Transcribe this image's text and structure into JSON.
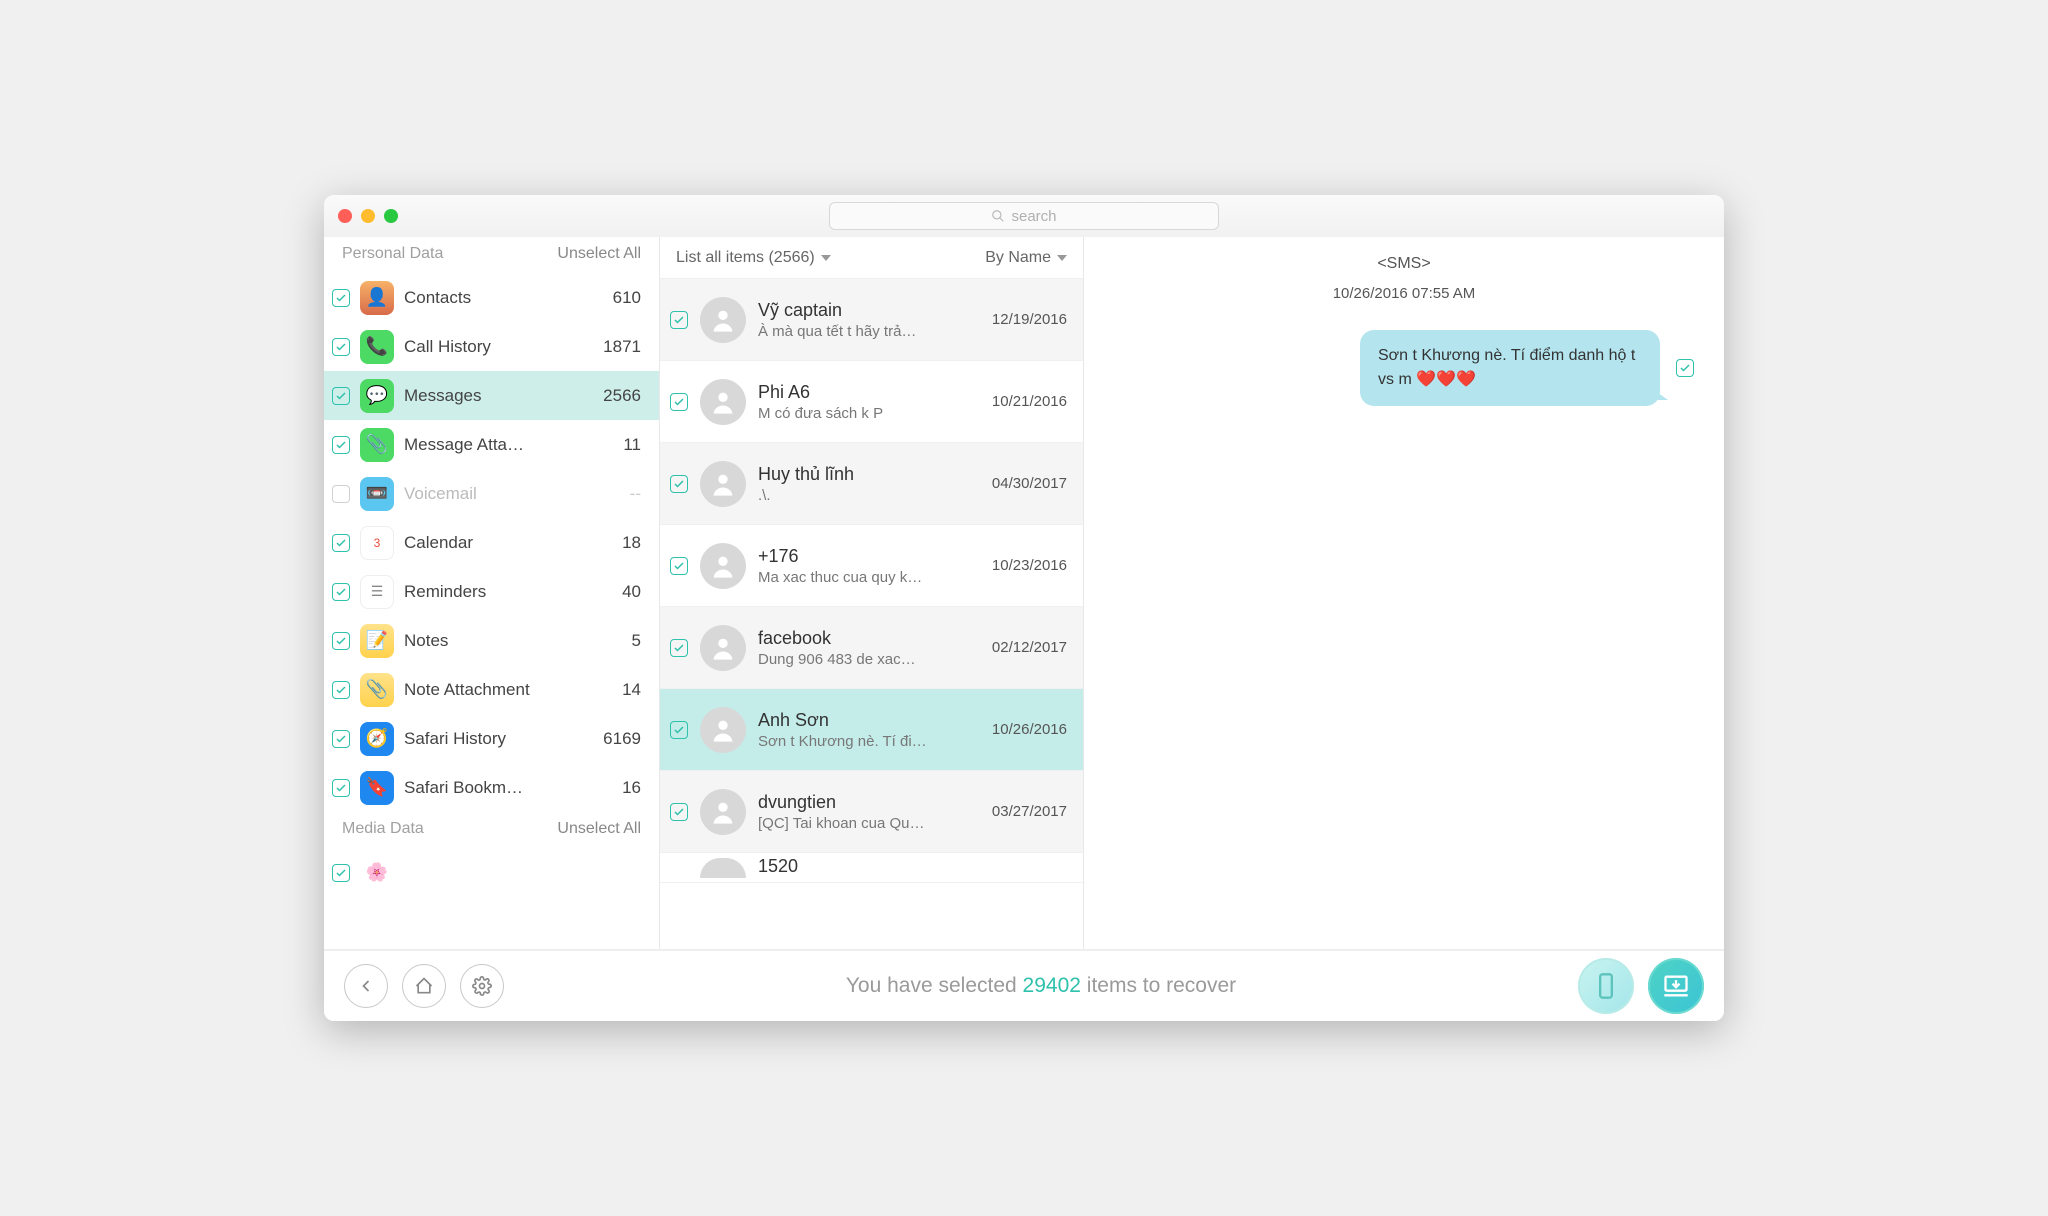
{
  "search": {
    "placeholder": "search"
  },
  "sidebar": {
    "section1": {
      "title": "Personal Data",
      "action": "Unselect All"
    },
    "section2": {
      "title": "Media Data",
      "action": "Unselect All"
    },
    "items": [
      {
        "label": "Contacts",
        "count": "610"
      },
      {
        "label": "Call History",
        "count": "1871"
      },
      {
        "label": "Messages",
        "count": "2566"
      },
      {
        "label": "Message Atta…",
        "count": "11"
      },
      {
        "label": "Voicemail",
        "count": "--"
      },
      {
        "label": "Calendar",
        "count": "18"
      },
      {
        "label": "Reminders",
        "count": "40"
      },
      {
        "label": "Notes",
        "count": "5"
      },
      {
        "label": "Note Attachment",
        "count": "14"
      },
      {
        "label": "Safari History",
        "count": "6169"
      },
      {
        "label": "Safari Bookm…",
        "count": "16"
      }
    ]
  },
  "list": {
    "header_left": "List all items (2566)",
    "header_right": "By Name",
    "items": [
      {
        "name": "Vỹ captain",
        "preview": "À mà qua tết t hãy trả…",
        "date": "12/19/2016"
      },
      {
        "name": "Phi A6",
        "preview": "M có đưa sách k P",
        "date": "10/21/2016"
      },
      {
        "name": "Huy thủ lĩnh",
        "preview": ".\\.",
        "date": "04/30/2017"
      },
      {
        "name": "+176",
        "preview": "Ma xac thuc cua quy k…",
        "date": "10/23/2016"
      },
      {
        "name": "facebook",
        "preview": "Dung 906 483 de xac…",
        "date": "02/12/2017"
      },
      {
        "name": "Anh Sơn",
        "preview": "Sơn t Khương nè. Tí đi…",
        "date": "10/26/2016"
      },
      {
        "name": "dvungtien",
        "preview": "[QC] Tai khoan cua Qu…",
        "date": "03/27/2017"
      },
      {
        "name": "1520",
        "preview": "",
        "date": ""
      }
    ]
  },
  "detail": {
    "type": "<SMS>",
    "timestamp": "10/26/2016 07:55 AM",
    "bubble": "Sơn t Khương nè. Tí điểm danh hộ t vs m ❤️❤️❤️"
  },
  "footer": {
    "pre": "You have selected ",
    "count": "29402",
    "post": " items to recover"
  }
}
